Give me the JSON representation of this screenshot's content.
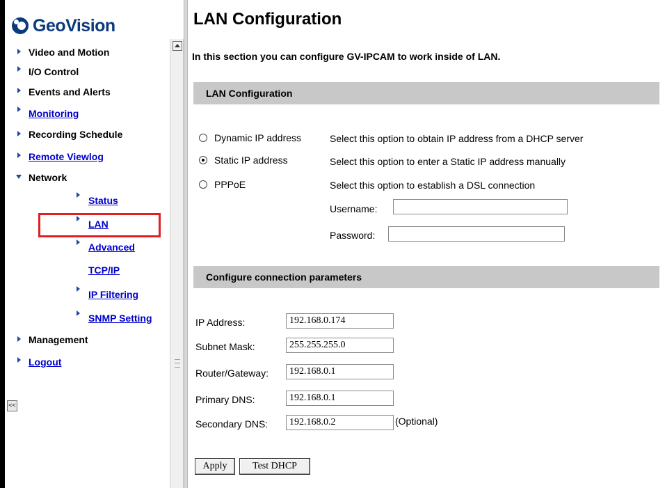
{
  "logo": {
    "text": "GeoVision"
  },
  "sidebar": {
    "items": [
      {
        "label": "Video and Motion"
      },
      {
        "label": "I/O Control"
      },
      {
        "label": "Events and Alerts"
      },
      {
        "label": "Monitoring"
      },
      {
        "label": "Recording Schedule"
      },
      {
        "label": "Remote Viewlog"
      },
      {
        "label": "Network"
      },
      {
        "label": "Management"
      },
      {
        "label": "Logout"
      }
    ],
    "network_children": [
      {
        "label": "Status"
      },
      {
        "label": "LAN"
      },
      {
        "label": "Advanced"
      },
      {
        "label": "TCP/IP"
      },
      {
        "label": "IP Filtering"
      },
      {
        "label": "SNMP Setting"
      }
    ],
    "collapse_label": "<<"
  },
  "main": {
    "title": "LAN Configuration",
    "intro": "In this section you can configure GV-IPCAM to work inside of LAN.",
    "section1": "LAN Configuration",
    "options": [
      {
        "label": "Dynamic IP address",
        "desc": "Select this option to obtain IP address from a DHCP server",
        "checked": false
      },
      {
        "label": "Static IP address",
        "desc": "Select this option to enter a Static IP address manually",
        "checked": true
      },
      {
        "label": "PPPoE",
        "desc": "Select this option to establish a DSL connection",
        "checked": false
      }
    ],
    "pppoe": {
      "username_label": "Username:",
      "username_value": "",
      "password_label": "Password:",
      "password_value": ""
    },
    "section2": "Configure connection parameters",
    "fields": [
      {
        "label": "IP Address:",
        "value": "192.168.0.174"
      },
      {
        "label": "Subnet Mask:",
        "value": "255.255.255.0"
      },
      {
        "label": "Router/Gateway:",
        "value": "192.168.0.1"
      },
      {
        "label": "Primary DNS:",
        "value": "192.168.0.1"
      },
      {
        "label": "Secondary DNS:",
        "value": "192.168.0.2"
      }
    ],
    "optional_note": "(Optional)",
    "buttons": {
      "apply": "Apply",
      "test_dhcp": "Test DHCP"
    }
  },
  "colors": {
    "link": "#0000cc",
    "brand": "#0b3a7a",
    "highlight": "#e41e1e",
    "section_bar": "#c8c8c8"
  }
}
